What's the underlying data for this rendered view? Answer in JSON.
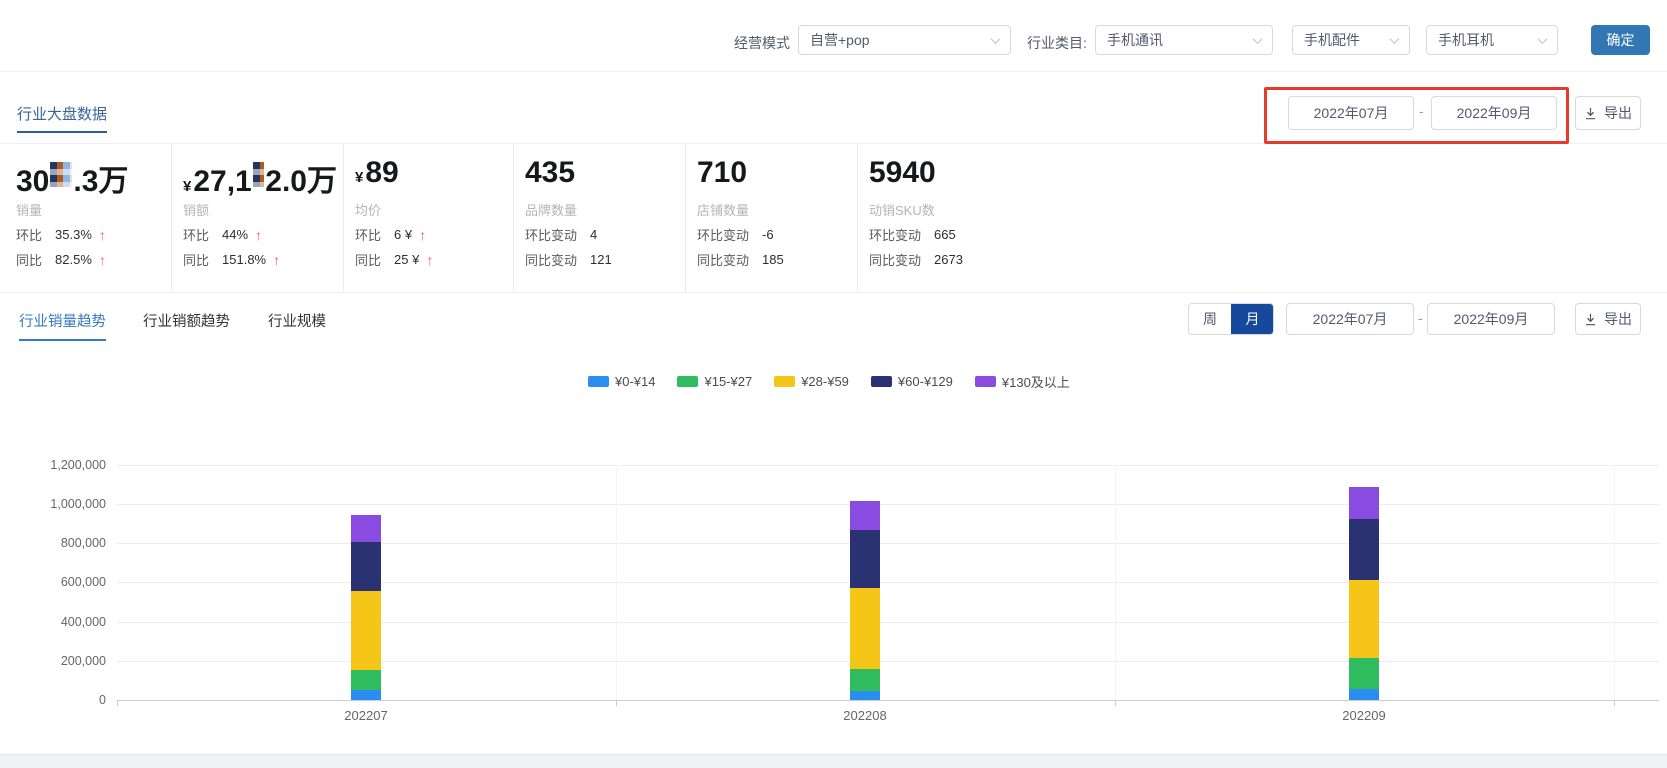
{
  "filter_bar": {
    "mode_label": "经营模式",
    "mode_value": "自营+pop",
    "category_label": "行业类目:",
    "categories": [
      "手机通讯",
      "手机配件",
      "手机耳机"
    ],
    "confirm_label": "确定"
  },
  "overview": {
    "title": "行业大盘数据",
    "range": {
      "start": "2022年07月",
      "sep": "-",
      "end": "2022年09月"
    },
    "export_label": "导出",
    "highlight_box_color": "#e63b2b",
    "cards": [
      {
        "id": "sales-volume",
        "label": "销量",
        "value_parts": [
          "30",
          {
            "censor": 22
          },
          ".3万"
        ],
        "rows": [
          {
            "k": "环比",
            "v": "35.3%",
            "arrow": "up"
          },
          {
            "k": "同比",
            "v": "82.5%",
            "arrow": "up"
          }
        ]
      },
      {
        "id": "sales-amount",
        "label": "销额",
        "currency": "¥",
        "value_parts": [
          "27,1",
          {
            "censor": 26
          },
          "2.0万"
        ],
        "rows": [
          {
            "k": "环比",
            "v": "44%",
            "arrow": "up"
          },
          {
            "k": "同比",
            "v": "151.8%",
            "arrow": "up"
          }
        ]
      },
      {
        "id": "avg-price",
        "label": "均价",
        "currency": "¥",
        "value_parts": [
          "89"
        ],
        "rows": [
          {
            "k": "环比",
            "v": "6 ¥",
            "arrow": "up"
          },
          {
            "k": "同比",
            "v": "25 ¥",
            "arrow": "up"
          }
        ]
      },
      {
        "id": "brand-count",
        "label": "品牌数量",
        "value_parts": [
          "435"
        ],
        "rows": [
          {
            "k": "环比变动",
            "v": "4"
          },
          {
            "k": "同比变动",
            "v": "121"
          }
        ]
      },
      {
        "id": "shop-count",
        "label": "店铺数量",
        "value_parts": [
          "710"
        ],
        "rows": [
          {
            "k": "环比变动",
            "v": "-6"
          },
          {
            "k": "同比变动",
            "v": "185"
          }
        ]
      },
      {
        "id": "sku-count",
        "label": "动销SKU数",
        "value_parts": [
          "5940"
        ],
        "rows": [
          {
            "k": "环比变动",
            "v": "665"
          },
          {
            "k": "同比变动",
            "v": "2673"
          }
        ]
      }
    ]
  },
  "trend": {
    "tabs": [
      {
        "label": "行业销量趋势",
        "active": true
      },
      {
        "label": "行业销额趋势",
        "active": false
      },
      {
        "label": "行业规模",
        "active": false
      }
    ],
    "period": [
      {
        "label": "周",
        "active": false
      },
      {
        "label": "月",
        "active": true
      }
    ],
    "range": {
      "start": "2022年07月",
      "sep": "-",
      "end": "2022年09月"
    },
    "export_label": "导出"
  },
  "chart_data": {
    "type": "bar",
    "stacked": true,
    "title": "",
    "xlabel": "",
    "ylabel": "",
    "categories": [
      "202207",
      "202208",
      "202209"
    ],
    "series": [
      {
        "name": "¥0-¥14",
        "color": "#2b8df0",
        "values": [
          50000,
          45000,
          55000
        ]
      },
      {
        "name": "¥15-¥27",
        "color": "#2fbd5f",
        "values": [
          105000,
          115000,
          160000
        ]
      },
      {
        "name": "¥28-¥59",
        "color": "#f5c518",
        "values": [
          400000,
          410000,
          395000
        ]
      },
      {
        "name": "¥60-¥129",
        "color": "#2a3274",
        "values": [
          250000,
          295000,
          315000
        ]
      },
      {
        "name": "¥130及以上",
        "color": "#8a4be0",
        "values": [
          140000,
          150000,
          160000
        ]
      }
    ],
    "ylim": [
      0,
      1200000
    ],
    "ytick_step": 200000,
    "ytick_labels": [
      "0",
      "200,000",
      "400,000",
      "600,000",
      "800,000",
      "1,000,000",
      "1,200,000"
    ],
    "legend_position": "top-center",
    "grid": true
  }
}
